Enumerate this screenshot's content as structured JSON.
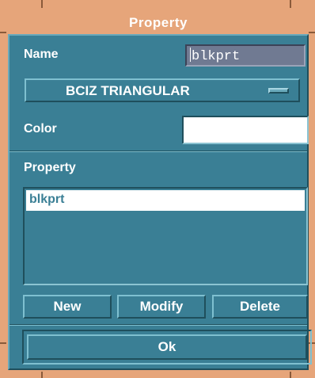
{
  "window": {
    "title": "Property"
  },
  "name": {
    "label": "Name",
    "value": "blkprt"
  },
  "type_option": {
    "selected": "BCIZ TRIANGULAR"
  },
  "color": {
    "label": "Color",
    "swatch": "#ffffff"
  },
  "property_list": {
    "label": "Property",
    "items": [
      "blkprt"
    ]
  },
  "actions": {
    "new": "New",
    "modify": "Modify",
    "delete": "Delete"
  },
  "ok": {
    "label": "Ok"
  },
  "colors": {
    "frame": "#e6a57a",
    "panel": "#3a7f95",
    "name_field": "#707a92"
  }
}
